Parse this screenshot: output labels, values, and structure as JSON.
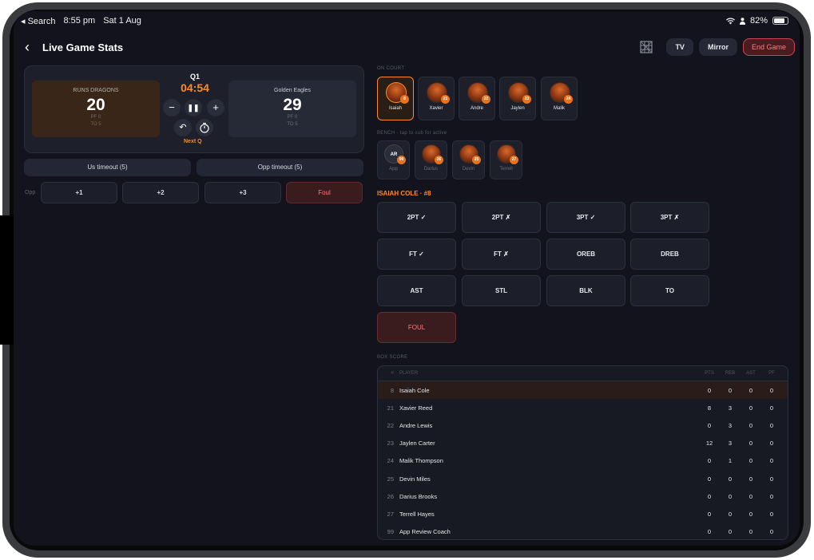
{
  "status_bar": {
    "back_app": "◂ Search",
    "time": "8:55 pm",
    "date": "Sat 1 Aug",
    "battery": "82%"
  },
  "header": {
    "title": "Live Game Stats",
    "tv": "TV",
    "mirror": "Mirror",
    "end_game": "End Game"
  },
  "scoreboard": {
    "us": {
      "name": "RUNS DRAGONS",
      "score": "20",
      "fouls": "PF 0",
      "timeouts": "TO 5"
    },
    "opp": {
      "name": "Golden Eagles",
      "score": "29",
      "fouls": "PF 0",
      "timeouts": "TO 5"
    },
    "quarter": "Q1",
    "clock": "04:54",
    "next_q": "Next Q",
    "icons": {
      "minus": "minus-icon",
      "pause": "pause-icon",
      "plus": "plus-icon",
      "undo": "undo-icon",
      "timer": "timer-icon"
    }
  },
  "timeouts": {
    "us": "Us timeout (5)",
    "opp": "Opp timeout (5)"
  },
  "opp_scoring": {
    "label": "Opp",
    "buttons": [
      "+1",
      "+2",
      "+3",
      "Foul"
    ]
  },
  "on_court": {
    "label": "ON COURT",
    "players": [
      {
        "name": "Isaiah",
        "num": "8",
        "active": true
      },
      {
        "name": "Xavier",
        "num": "21"
      },
      {
        "name": "Andre",
        "num": "22"
      },
      {
        "name": "Jaylen",
        "num": "23"
      },
      {
        "name": "Malik",
        "num": "24"
      }
    ]
  },
  "bench": {
    "label": "BENCH · tap to sub for active",
    "players": [
      {
        "name": "App",
        "num": "99",
        "initials": "AR"
      },
      {
        "name": "Darius",
        "num": "26"
      },
      {
        "name": "Devin",
        "num": "25"
      },
      {
        "name": "Terrell",
        "num": "27"
      }
    ]
  },
  "selected_player": "ISAIAH COLE · #8",
  "stat_buttons": [
    "2PT ✓",
    "2PT ✗",
    "3PT ✓",
    "3PT ✗",
    "FT ✓",
    "FT ✗",
    "OREB",
    "DREB",
    "AST",
    "STL",
    "BLK",
    "TO",
    "FOUL"
  ],
  "box_score": {
    "label": "BOX SCORE",
    "columns": [
      "#",
      "PLAYER",
      "PTS",
      "REB",
      "AST",
      "PF"
    ],
    "rows": [
      [
        "8",
        "Isaiah Cole",
        "0",
        "0",
        "0",
        "0"
      ],
      [
        "21",
        "Xavier Reed",
        "8",
        "3",
        "0",
        "0"
      ],
      [
        "22",
        "Andre Lewis",
        "0",
        "3",
        "0",
        "0"
      ],
      [
        "23",
        "Jaylen Carter",
        "12",
        "3",
        "0",
        "0"
      ],
      [
        "24",
        "Malik Thompson",
        "0",
        "1",
        "0",
        "0"
      ],
      [
        "25",
        "Devin Miles",
        "0",
        "0",
        "0",
        "0"
      ],
      [
        "26",
        "Darius Brooks",
        "0",
        "0",
        "0",
        "0"
      ],
      [
        "27",
        "Terrell Hayes",
        "0",
        "0",
        "0",
        "0"
      ],
      [
        "99",
        "App Review Coach",
        "0",
        "0",
        "0",
        "0"
      ]
    ]
  }
}
